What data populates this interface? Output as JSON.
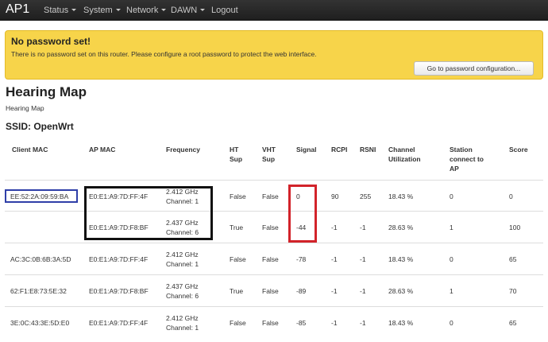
{
  "nav": {
    "brand": "AP1",
    "items": [
      {
        "label": "Status",
        "dropdown": true
      },
      {
        "label": "System",
        "dropdown": true
      },
      {
        "label": "Network",
        "dropdown": true
      },
      {
        "label": "DAWN",
        "dropdown": true
      },
      {
        "label": "Logout",
        "dropdown": false
      }
    ]
  },
  "alert": {
    "title": "No password set!",
    "text": "There is no password set on this router. Please configure a root password to protect the web interface.",
    "button": "Go to password configuration..."
  },
  "page": {
    "title": "Hearing Map",
    "description": "Hearing Map",
    "ssid": "SSID: OpenWrt"
  },
  "table": {
    "headers": {
      "client_mac": "Client MAC",
      "ap_mac": "AP MAC",
      "frequency": "Frequency",
      "ht_sup": [
        "HT",
        "Sup"
      ],
      "vht_sup": [
        "VHT",
        "Sup"
      ],
      "signal": "Signal",
      "rcpi": "RCPI",
      "rsni": "RSNI",
      "channel_util": [
        "Channel",
        "Utilization"
      ],
      "station_connect": [
        "Station",
        "connect to",
        "AP"
      ],
      "score": "Score"
    },
    "rows": [
      {
        "client_mac": "EE:52:2A:09:59:BA",
        "ap_mac": "E0:E1:A9:7D:FF:4F",
        "freq": "2.412 GHz",
        "channel": "Channel: 1",
        "ht": "False",
        "vht": "False",
        "signal": "0",
        "rcpi": "90",
        "rsni": "255",
        "util": "18.43 %",
        "connected": "0",
        "score": "0"
      },
      {
        "client_mac": "",
        "ap_mac": "E0:E1:A9:7D:F8:BF",
        "freq": "2.437 GHz",
        "channel": "Channel: 6",
        "ht": "True",
        "vht": "False",
        "signal": "-44",
        "rcpi": "-1",
        "rsni": "-1",
        "util": "28.63 %",
        "connected": "1",
        "score": "100"
      },
      {
        "client_mac": "AC:3C:0B:6B:3A:5D",
        "ap_mac": "E0:E1:A9:7D:FF:4F",
        "freq": "2.412 GHz",
        "channel": "Channel: 1",
        "ht": "False",
        "vht": "False",
        "signal": "-78",
        "rcpi": "-1",
        "rsni": "-1",
        "util": "18.43 %",
        "connected": "0",
        "score": "65"
      },
      {
        "client_mac": "62:F1:E8:73:5E:32",
        "ap_mac": "E0:E1:A9:7D:F8:BF",
        "freq": "2.437 GHz",
        "channel": "Channel: 6",
        "ht": "True",
        "vht": "False",
        "signal": "-89",
        "rcpi": "-1",
        "rsni": "-1",
        "util": "28.63 %",
        "connected": "1",
        "score": "70"
      },
      {
        "client_mac": "3E:0C:43:3E:5D:E0",
        "ap_mac": "E0:E1:A9:7D:FF:4F",
        "freq": "2.412 GHz",
        "channel": "Channel: 1",
        "ht": "False",
        "vht": "False",
        "signal": "-85",
        "rcpi": "-1",
        "rsni": "-1",
        "util": "18.43 %",
        "connected": "0",
        "score": "65"
      }
    ]
  },
  "colors": {
    "navbar": "#222222",
    "alert_bg": "#f7d44a",
    "highlight_blue": "#2f3fa8",
    "highlight_black": "#111111",
    "highlight_red": "#d2232a"
  }
}
